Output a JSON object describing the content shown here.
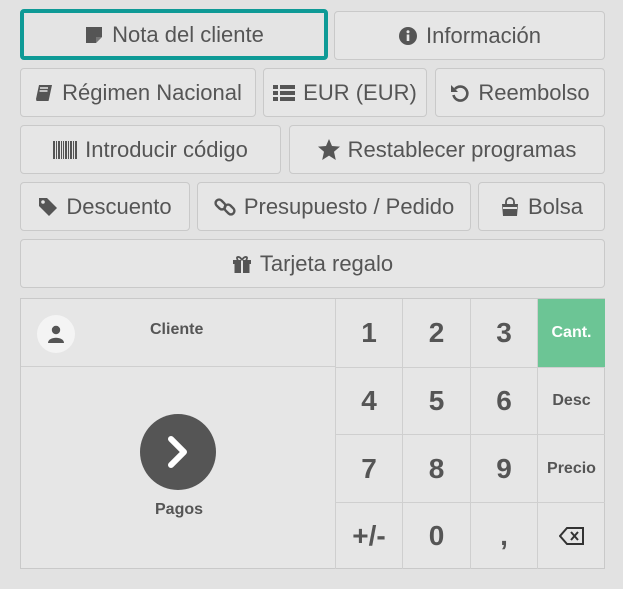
{
  "actions": {
    "customer_note": "Nota del cliente",
    "info": "Información",
    "tax_regime": "Régimen Nacional",
    "currency": "EUR (EUR)",
    "refund": "Reembolso",
    "enter_code": "Introducir código",
    "reset_programs": "Restablecer programas",
    "discount": "Descuento",
    "quotation": "Presupuesto / Pedido",
    "bag": "Bolsa",
    "gift_card": "Tarjeta regalo"
  },
  "pad": {
    "customer_label": "Cliente",
    "payment_label": "Pagos",
    "keys": [
      "1",
      "2",
      "3",
      "4",
      "5",
      "6",
      "7",
      "8",
      "9",
      "+/-",
      "0",
      ","
    ],
    "mode_qty": "Cant.",
    "mode_disc": "Desc",
    "mode_price": "Precio"
  },
  "colors": {
    "highlight": "#0e9a96",
    "qty_active": "#6cc595"
  }
}
